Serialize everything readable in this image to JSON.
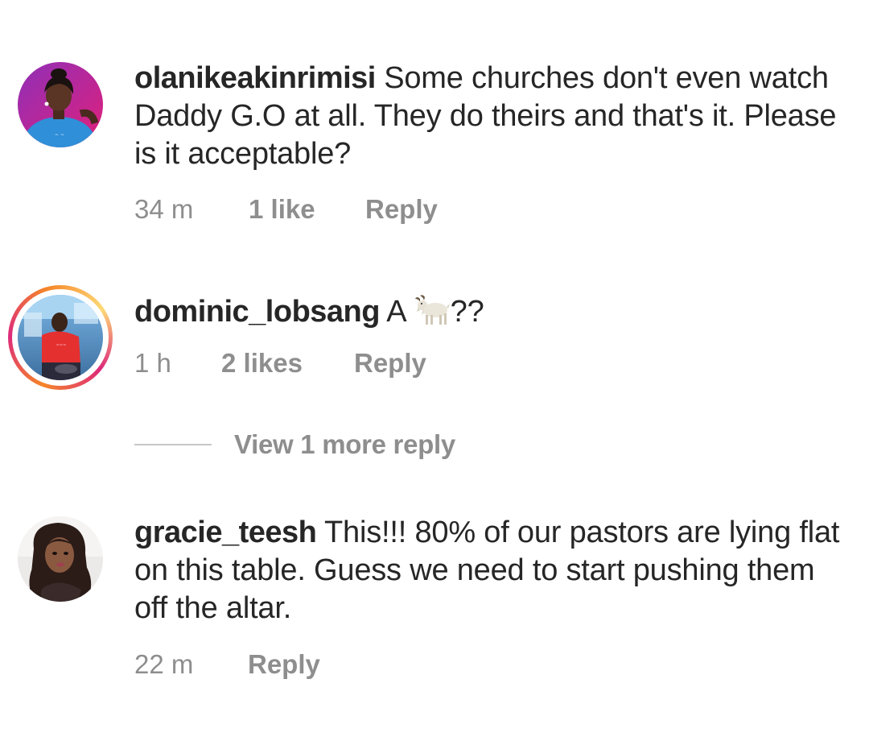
{
  "comments": [
    {
      "username": "olanikeakinrimisi",
      "text": " Some churches don't even watch Daddy G.O at all. They do theirs and that's it. Please is it acceptable?",
      "time": "34 m",
      "likes": "1 like",
      "reply": "Reply"
    },
    {
      "username": "dominic_lobsang",
      "text_before": " A ",
      "text_after": "??",
      "emoji": "goat-icon",
      "time": "1 h",
      "likes": "2 likes",
      "reply": "Reply",
      "view_replies": "View 1 more reply"
    },
    {
      "username": "gracie_teesh",
      "text": " This!!! 80% of our pastors are lying flat on this table.  Guess we need to start pushing them off the altar.",
      "time": "22 m",
      "reply": "Reply"
    }
  ],
  "colors": {
    "text": "#262626",
    "meta": "#8e8e8e",
    "divider": "#c7c7c7"
  }
}
